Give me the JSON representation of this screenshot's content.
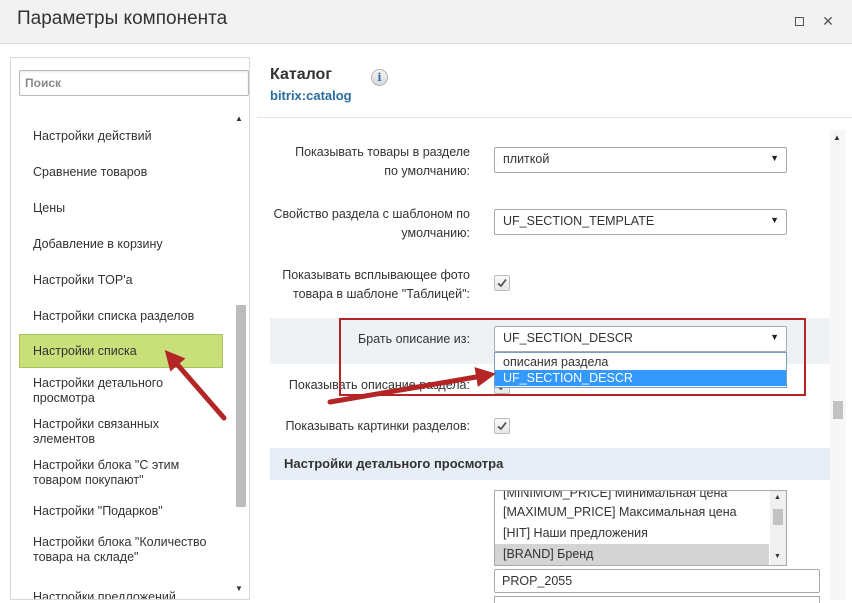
{
  "window": {
    "title": "Параметры компонента",
    "maximize_icon": "maximize-icon",
    "close_icon": "close-icon",
    "close_glyph": "✕"
  },
  "sidebar": {
    "search_placeholder": "Поиск",
    "items": [
      {
        "label": "Настройки действий"
      },
      {
        "label": "Сравнение товаров"
      },
      {
        "label": "Цены"
      },
      {
        "label": "Добавление в корзину"
      },
      {
        "label": "Настройки TOP'а"
      },
      {
        "label": "Настройки списка разделов"
      },
      {
        "label": "Настройки списка"
      },
      {
        "label": "Настройки детального просмотра"
      },
      {
        "label": "Настройки связанных элементов"
      },
      {
        "label": "Настройки блока \"С этим товаром покупают\""
      },
      {
        "label": "Настройки \"Подарков\""
      },
      {
        "label": "Настройки блока \"Количество товара на складе\""
      },
      {
        "label": "Настройки предложений"
      }
    ],
    "active_index": 6
  },
  "main": {
    "title": "Каталог",
    "subtitle": "bitrix:catalog",
    "info_glyph": "i",
    "fields": {
      "show_goods": {
        "label": "Показывать товары в разделе по умолчанию:",
        "value": "плиткой"
      },
      "section_template": {
        "label": "Свойство раздела с шаблоном по умолчанию:",
        "value": "UF_SECTION_TEMPLATE"
      },
      "popup_photo": {
        "label": "Показывать всплывающее фото товара в шаблоне \"Таблицей\":",
        "checked": true
      },
      "description_from": {
        "label": "Брать описание из:",
        "value": "UF_SECTION_DESCR",
        "options": [
          "описания раздела",
          "UF_SECTION_DESCR"
        ],
        "selected_option": 1
      },
      "show_section_descr": {
        "label": "Показывать описание раздела:",
        "checked": true
      },
      "show_section_pictures": {
        "label": "Показывать картинки разделов:",
        "checked": true
      }
    },
    "section_header": "Настройки детального просмотра",
    "detail_list": {
      "items": [
        "[MINIMUM_PRICE] Минимальная цена",
        "[MAXIMUM_PRICE] Максимальная цена",
        "[HIT] Наши предложения",
        "[BRAND] Бренд"
      ],
      "selected_index": 3
    },
    "prop_input_value": "PROP_2055"
  },
  "colors": {
    "active_item_bg": "#c9e07a",
    "annotation_red": "#b42525",
    "dropdown_selected": "#3399ff",
    "link_blue": "#2a6ca0"
  }
}
